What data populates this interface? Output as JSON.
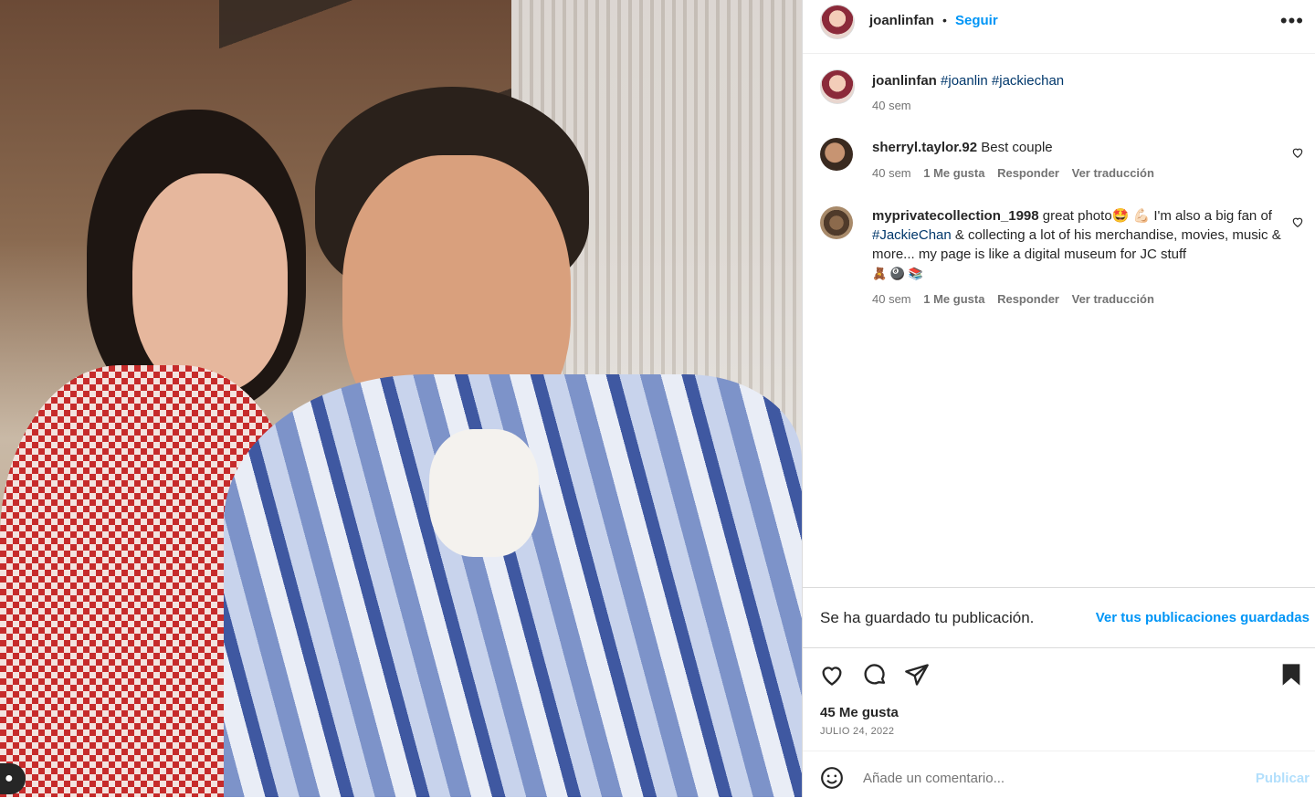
{
  "post": {
    "author": "joanlinfan",
    "follow_label": "Seguir",
    "separator": "•",
    "more_icon": "more-horizontal-icon",
    "caption_tags": [
      "#joanlin",
      "#jackiechan"
    ],
    "caption_time": "40 sem"
  },
  "comments": [
    {
      "user": "sherryl.taylor.92",
      "text": "Best couple",
      "time": "40 sem",
      "likes": "1 Me gusta",
      "reply": "Responder",
      "translate": "Ver traducción"
    },
    {
      "user": "myprivatecollection_1998",
      "text_a": "great photo🤩 💪🏻 I'm also a big fan of ",
      "tag": "#JackieChan",
      "text_b": " & collecting a lot of his merchandise, movies, music & more... my page is like a digital museum for JC stuff",
      "emojis": "🧸 🎱 📚",
      "time": "40 sem",
      "likes": "1 Me gusta",
      "reply": "Responder",
      "translate": "Ver traducción"
    }
  ],
  "saved": {
    "message": "Se ha guardado tu publicación.",
    "link": "Ver tus publicaciones guardadas"
  },
  "footer": {
    "likes": "45 Me gusta",
    "date": "JULIO 24, 2022",
    "comment_placeholder": "Añade un comentario...",
    "publish": "Publicar"
  },
  "colors": {
    "accent": "#0095f6",
    "hashtag": "#00376b",
    "publish_disabled": "#b2dffc"
  }
}
